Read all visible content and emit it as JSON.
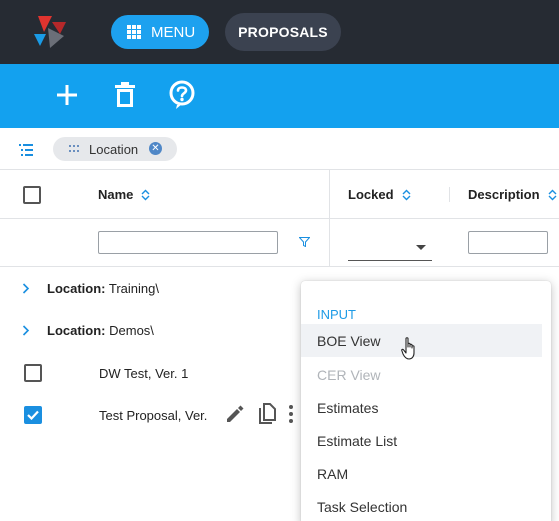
{
  "topbar": {
    "menu_label": "MENU",
    "proposals_label": "PROPOSALS"
  },
  "toolbar": {
    "icons": [
      "add-icon",
      "delete-icon",
      "help-icon"
    ]
  },
  "groupbar": {
    "chip_label": "Location"
  },
  "grid": {
    "columns": [
      "Name",
      "Locked",
      "Description"
    ],
    "groups": [
      {
        "prefix": "Location:",
        "value": "Training\\"
      },
      {
        "prefix": "Location:",
        "value": "Demos\\"
      }
    ],
    "rows": [
      {
        "name": "DW Test, Ver. 1",
        "checked": false
      },
      {
        "name": "Test Proposal, Ver.",
        "checked": true
      }
    ]
  },
  "context_menu": {
    "section": "INPUT",
    "items": [
      {
        "label": "BOE View",
        "state": "hover"
      },
      {
        "label": "CER View",
        "state": "disabled"
      },
      {
        "label": "Estimates",
        "state": "normal"
      },
      {
        "label": "Estimate List",
        "state": "normal"
      },
      {
        "label": "RAM",
        "state": "normal"
      },
      {
        "label": "Task Selection",
        "state": "normal"
      }
    ]
  },
  "colors": {
    "topbar": "#262b33",
    "accent": "#13a1ef",
    "checkbox_checked": "#1a8fe0",
    "section_text": "#1e9be6"
  }
}
